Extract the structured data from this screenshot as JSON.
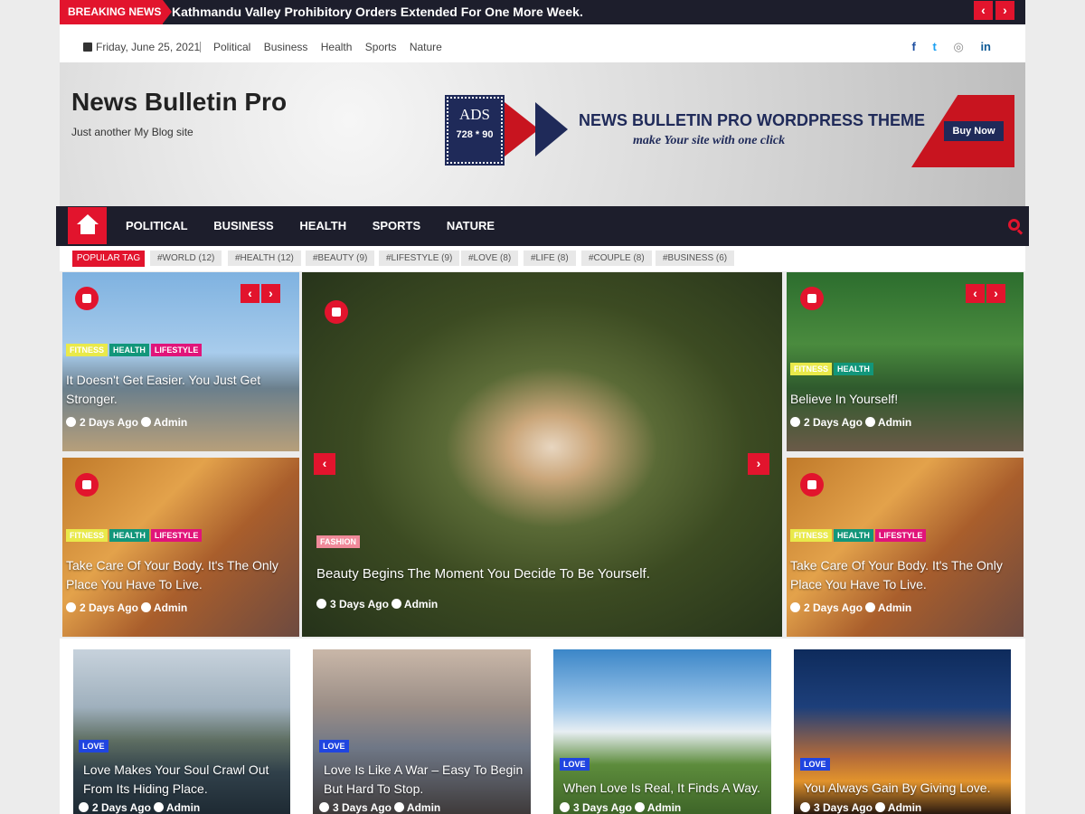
{
  "breaking": {
    "label": "BREAKING NEWS",
    "headline": "Kathmandu Valley Prohibitory Orders Extended For One More Week.",
    "prev": "‹",
    "next": "›"
  },
  "topbar": {
    "date": "Friday, June 25, 2021",
    "links": [
      "Political",
      "Business",
      "Health",
      "Sports",
      "Nature"
    ],
    "social": [
      "f",
      "t",
      "◎",
      "in"
    ]
  },
  "header": {
    "title": "News Bulletin Pro",
    "tagline": "Just another My Blog site"
  },
  "banner": {
    "ads": "ADS",
    "size": "728 * 90",
    "title": "NEWS BULLETIN PRO WORDPRESS THEME",
    "subtitle": "make Your site with one click",
    "button": "Buy Now"
  },
  "nav": {
    "items": [
      "POLITICAL",
      "BUSINESS",
      "HEALTH",
      "SPORTS",
      "NATURE"
    ]
  },
  "tags": {
    "label": "POPULAR TAG",
    "items": [
      "#WORLD (12)",
      "#HEALTH (12)",
      "#BEAUTY (9)",
      "#LIFESTYLE (9)",
      "#LOVE (8)",
      "#LIFE (8)",
      "#COUPLE (8)",
      "#BUSINESS (6)"
    ]
  },
  "featured": {
    "left_top": {
      "cats": [
        "FITNESS",
        "HEALTH",
        "LIFESTYLE"
      ],
      "title": "It Doesn't Get Easier. You Just Get Stronger.",
      "time": "2 Days Ago",
      "author": "Admin"
    },
    "left_bottom": {
      "cats": [
        "FITNESS",
        "HEALTH",
        "LIFESTYLE"
      ],
      "title": "Take Care Of Your Body. It's The Only Place You Have To Live.",
      "time": "2 Days Ago",
      "author": "Admin"
    },
    "center": {
      "cats": [
        "FASHION"
      ],
      "title": "Beauty Begins The Moment You Decide To Be Yourself.",
      "time": "3 Days Ago",
      "author": "Admin"
    },
    "right_top": {
      "cats": [
        "FITNESS",
        "HEALTH"
      ],
      "title": "Believe In Yourself!",
      "time": "2 Days Ago",
      "author": "Admin"
    },
    "right_bottom": {
      "cats": [
        "FITNESS",
        "HEALTH",
        "LIFESTYLE"
      ],
      "title": "Take Care Of Your Body. It's The Only Place You Have To Live.",
      "time": "2 Days Ago",
      "author": "Admin"
    }
  },
  "posts": [
    {
      "cat": "LOVE",
      "title": "Love Makes Your Soul Crawl Out From Its Hiding Place.",
      "time": "2 Days Ago",
      "author": "Admin"
    },
    {
      "cat": "LOVE",
      "title": "Love Is Like A War – Easy To Begin But Hard To Stop.",
      "time": "3 Days Ago",
      "author": "Admin"
    },
    {
      "cat": "LOVE",
      "title": "When Love Is Real, It Finds A Way.",
      "time": "3 Days Ago",
      "author": "Admin"
    },
    {
      "cat": "LOVE",
      "title": "You Always Gain By Giving Love.",
      "time": "3 Days Ago",
      "author": "Admin"
    }
  ],
  "colors": {
    "accent": "#e2142d",
    "dark": "#1d1e2c",
    "navy": "#1f2a59"
  }
}
